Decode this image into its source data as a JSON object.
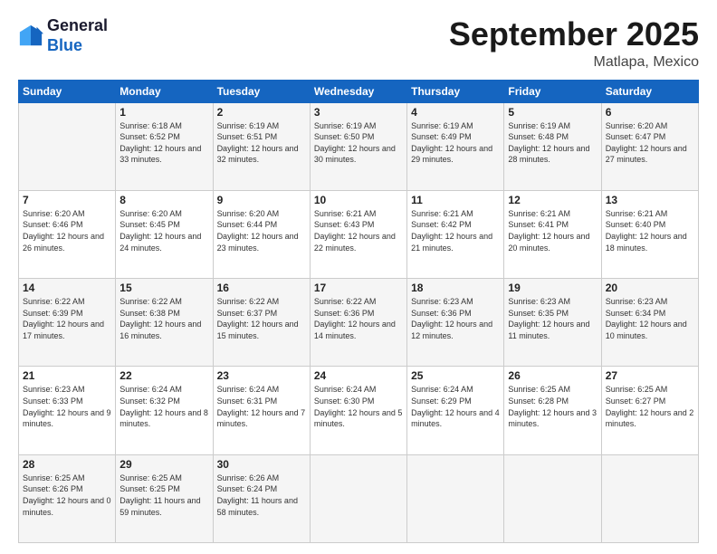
{
  "logo": {
    "line1": "General",
    "line2": "Blue"
  },
  "header": {
    "month": "September 2025",
    "location": "Matlapa, Mexico"
  },
  "weekdays": [
    "Sunday",
    "Monday",
    "Tuesday",
    "Wednesday",
    "Thursday",
    "Friday",
    "Saturday"
  ],
  "weeks": [
    [
      {
        "day": "",
        "sunrise": "",
        "sunset": "",
        "daylight": ""
      },
      {
        "day": "1",
        "sunrise": "Sunrise: 6:18 AM",
        "sunset": "Sunset: 6:52 PM",
        "daylight": "Daylight: 12 hours and 33 minutes."
      },
      {
        "day": "2",
        "sunrise": "Sunrise: 6:19 AM",
        "sunset": "Sunset: 6:51 PM",
        "daylight": "Daylight: 12 hours and 32 minutes."
      },
      {
        "day": "3",
        "sunrise": "Sunrise: 6:19 AM",
        "sunset": "Sunset: 6:50 PM",
        "daylight": "Daylight: 12 hours and 30 minutes."
      },
      {
        "day": "4",
        "sunrise": "Sunrise: 6:19 AM",
        "sunset": "Sunset: 6:49 PM",
        "daylight": "Daylight: 12 hours and 29 minutes."
      },
      {
        "day": "5",
        "sunrise": "Sunrise: 6:19 AM",
        "sunset": "Sunset: 6:48 PM",
        "daylight": "Daylight: 12 hours and 28 minutes."
      },
      {
        "day": "6",
        "sunrise": "Sunrise: 6:20 AM",
        "sunset": "Sunset: 6:47 PM",
        "daylight": "Daylight: 12 hours and 27 minutes."
      }
    ],
    [
      {
        "day": "7",
        "sunrise": "Sunrise: 6:20 AM",
        "sunset": "Sunset: 6:46 PM",
        "daylight": "Daylight: 12 hours and 26 minutes."
      },
      {
        "day": "8",
        "sunrise": "Sunrise: 6:20 AM",
        "sunset": "Sunset: 6:45 PM",
        "daylight": "Daylight: 12 hours and 24 minutes."
      },
      {
        "day": "9",
        "sunrise": "Sunrise: 6:20 AM",
        "sunset": "Sunset: 6:44 PM",
        "daylight": "Daylight: 12 hours and 23 minutes."
      },
      {
        "day": "10",
        "sunrise": "Sunrise: 6:21 AM",
        "sunset": "Sunset: 6:43 PM",
        "daylight": "Daylight: 12 hours and 22 minutes."
      },
      {
        "day": "11",
        "sunrise": "Sunrise: 6:21 AM",
        "sunset": "Sunset: 6:42 PM",
        "daylight": "Daylight: 12 hours and 21 minutes."
      },
      {
        "day": "12",
        "sunrise": "Sunrise: 6:21 AM",
        "sunset": "Sunset: 6:41 PM",
        "daylight": "Daylight: 12 hours and 20 minutes."
      },
      {
        "day": "13",
        "sunrise": "Sunrise: 6:21 AM",
        "sunset": "Sunset: 6:40 PM",
        "daylight": "Daylight: 12 hours and 18 minutes."
      }
    ],
    [
      {
        "day": "14",
        "sunrise": "Sunrise: 6:22 AM",
        "sunset": "Sunset: 6:39 PM",
        "daylight": "Daylight: 12 hours and 17 minutes."
      },
      {
        "day": "15",
        "sunrise": "Sunrise: 6:22 AM",
        "sunset": "Sunset: 6:38 PM",
        "daylight": "Daylight: 12 hours and 16 minutes."
      },
      {
        "day": "16",
        "sunrise": "Sunrise: 6:22 AM",
        "sunset": "Sunset: 6:37 PM",
        "daylight": "Daylight: 12 hours and 15 minutes."
      },
      {
        "day": "17",
        "sunrise": "Sunrise: 6:22 AM",
        "sunset": "Sunset: 6:36 PM",
        "daylight": "Daylight: 12 hours and 14 minutes."
      },
      {
        "day": "18",
        "sunrise": "Sunrise: 6:23 AM",
        "sunset": "Sunset: 6:36 PM",
        "daylight": "Daylight: 12 hours and 12 minutes."
      },
      {
        "day": "19",
        "sunrise": "Sunrise: 6:23 AM",
        "sunset": "Sunset: 6:35 PM",
        "daylight": "Daylight: 12 hours and 11 minutes."
      },
      {
        "day": "20",
        "sunrise": "Sunrise: 6:23 AM",
        "sunset": "Sunset: 6:34 PM",
        "daylight": "Daylight: 12 hours and 10 minutes."
      }
    ],
    [
      {
        "day": "21",
        "sunrise": "Sunrise: 6:23 AM",
        "sunset": "Sunset: 6:33 PM",
        "daylight": "Daylight: 12 hours and 9 minutes."
      },
      {
        "day": "22",
        "sunrise": "Sunrise: 6:24 AM",
        "sunset": "Sunset: 6:32 PM",
        "daylight": "Daylight: 12 hours and 8 minutes."
      },
      {
        "day": "23",
        "sunrise": "Sunrise: 6:24 AM",
        "sunset": "Sunset: 6:31 PM",
        "daylight": "Daylight: 12 hours and 7 minutes."
      },
      {
        "day": "24",
        "sunrise": "Sunrise: 6:24 AM",
        "sunset": "Sunset: 6:30 PM",
        "daylight": "Daylight: 12 hours and 5 minutes."
      },
      {
        "day": "25",
        "sunrise": "Sunrise: 6:24 AM",
        "sunset": "Sunset: 6:29 PM",
        "daylight": "Daylight: 12 hours and 4 minutes."
      },
      {
        "day": "26",
        "sunrise": "Sunrise: 6:25 AM",
        "sunset": "Sunset: 6:28 PM",
        "daylight": "Daylight: 12 hours and 3 minutes."
      },
      {
        "day": "27",
        "sunrise": "Sunrise: 6:25 AM",
        "sunset": "Sunset: 6:27 PM",
        "daylight": "Daylight: 12 hours and 2 minutes."
      }
    ],
    [
      {
        "day": "28",
        "sunrise": "Sunrise: 6:25 AM",
        "sunset": "Sunset: 6:26 PM",
        "daylight": "Daylight: 12 hours and 0 minutes."
      },
      {
        "day": "29",
        "sunrise": "Sunrise: 6:25 AM",
        "sunset": "Sunset: 6:25 PM",
        "daylight": "Daylight: 11 hours and 59 minutes."
      },
      {
        "day": "30",
        "sunrise": "Sunrise: 6:26 AM",
        "sunset": "Sunset: 6:24 PM",
        "daylight": "Daylight: 11 hours and 58 minutes."
      },
      {
        "day": "",
        "sunrise": "",
        "sunset": "",
        "daylight": ""
      },
      {
        "day": "",
        "sunrise": "",
        "sunset": "",
        "daylight": ""
      },
      {
        "day": "",
        "sunrise": "",
        "sunset": "",
        "daylight": ""
      },
      {
        "day": "",
        "sunrise": "",
        "sunset": "",
        "daylight": ""
      }
    ]
  ]
}
